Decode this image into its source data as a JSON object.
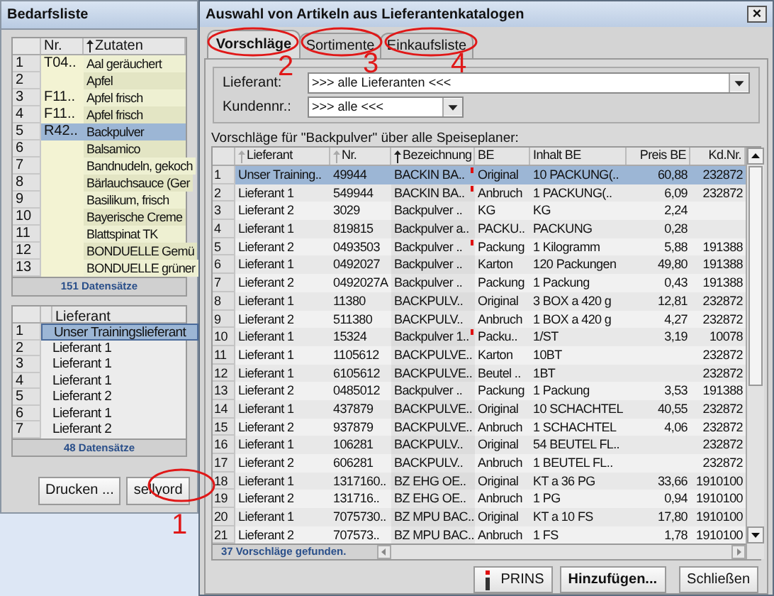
{
  "left_window": {
    "title": "Bedarfsliste",
    "ingredients_table": {
      "columns": [
        {
          "label": "Nr.",
          "sorted": false
        },
        {
          "label": "Zutaten",
          "sorted": true,
          "active": true
        }
      ],
      "rows": [
        {
          "num": "1",
          "nr": "T04..",
          "name": "Aal geräuchert",
          "selected": false
        },
        {
          "num": "2",
          "nr": "",
          "name": "Apfel",
          "selected": false
        },
        {
          "num": "3",
          "nr": "F11..",
          "name": "Apfel frisch",
          "selected": false
        },
        {
          "num": "4",
          "nr": "F11..",
          "name": "Apfel frisch",
          "selected": false
        },
        {
          "num": "5",
          "nr": "R42..",
          "name": "Backpulver",
          "selected": true
        },
        {
          "num": "6",
          "nr": "",
          "name": "Balsamico",
          "selected": false
        },
        {
          "num": "7",
          "nr": "",
          "name": "Bandnudeln, gekoch",
          "selected": false
        },
        {
          "num": "8",
          "nr": "",
          "name": "Bärlauchsauce (Ger",
          "selected": false
        },
        {
          "num": "9",
          "nr": "",
          "name": "Basilikum, frisch",
          "selected": false
        },
        {
          "num": "10",
          "nr": "",
          "name": "Bayerische Creme",
          "selected": false
        },
        {
          "num": "11",
          "nr": "",
          "name": "Blattspinat TK",
          "selected": false
        },
        {
          "num": "12",
          "nr": "",
          "name": "BONDUELLE Gemü",
          "selected": false
        },
        {
          "num": "13",
          "nr": "",
          "name": "BONDUELLE grüner",
          "selected": false
        }
      ],
      "footer": "151 Datensätze"
    },
    "supplier_table": {
      "columns": [
        {
          "label": "Lieferant"
        }
      ],
      "rows": [
        {
          "num": "1",
          "name": "Unser Trainingslieferant",
          "selected": true
        },
        {
          "num": "2",
          "name": "Lieferant 1",
          "selected": false
        },
        {
          "num": "3",
          "name": "Lieferant 1",
          "selected": false
        },
        {
          "num": "4",
          "name": "Lieferant 1",
          "selected": false
        },
        {
          "num": "5",
          "name": "Lieferant 2",
          "selected": false
        },
        {
          "num": "6",
          "name": "Lieferant 1",
          "selected": false
        },
        {
          "num": "7",
          "name": "Lieferant 2",
          "selected": false
        }
      ],
      "footer": "48 Datensätze"
    },
    "buttons": [
      "Drucken ...",
      "sellyord"
    ]
  },
  "dialog": {
    "title": "Auswahl von Artikeln aus Lieferantenkatalogen",
    "close": "×",
    "tabs": [
      {
        "label": "Vorschläge",
        "selected": true
      },
      {
        "label": "Sortimente",
        "selected": false
      },
      {
        "label": "Einkaufsliste",
        "selected": false
      }
    ],
    "filters": [
      {
        "label": "Lieferant:",
        "value": ">>> alle Lieferanten <<<"
      },
      {
        "label": "Kundennr.:",
        "value": ">>> alle <<<"
      }
    ],
    "caption": "Vorschläge für \"Backpulver\" über alle Speiseplaner:",
    "table": {
      "columns": [
        {
          "label": "Lieferant",
          "sorted": true,
          "active": false
        },
        {
          "label": "Nr.",
          "sorted": true,
          "active": false
        },
        {
          "label": "Bezeichnung",
          "sorted": true,
          "active": true
        },
        {
          "label": "BE",
          "sorted": false
        },
        {
          "label": "Inhalt BE",
          "sorted": false
        },
        {
          "label": "Preis BE",
          "sorted": false
        },
        {
          "label": "Kd.Nr.",
          "sorted": false
        }
      ],
      "rows": [
        {
          "num": "1",
          "cells": [
            "Unser Training..",
            "49944",
            "BACKIN BA..",
            "Original",
            "10 PACKUNG(..",
            "60,88",
            "232872"
          ],
          "flagged": true,
          "selected": true
        },
        {
          "num": "2",
          "cells": [
            "Lieferant 1",
            "549944",
            "BACKIN BA..",
            "Anbruch",
            "1 PACKUNG(..",
            "6,09",
            "232872"
          ],
          "flagged": true,
          "selected": false
        },
        {
          "num": "3",
          "cells": [
            "Lieferant 2",
            "3029",
            "Backpulver ..",
            "KG",
            "KG",
            "2,24",
            ""
          ],
          "flagged": false,
          "selected": false
        },
        {
          "num": "4",
          "cells": [
            "Lieferant 1",
            "819815",
            "Backpulver a..",
            "PACKU..",
            "PACKUNG",
            "0,28",
            ""
          ],
          "flagged": false,
          "selected": false
        },
        {
          "num": "5",
          "cells": [
            "Lieferant 2",
            "0493503",
            "Backpulver ..",
            "Packung",
            "1 Kilogramm",
            "5,88",
            "191388"
          ],
          "flagged": true,
          "selected": false
        },
        {
          "num": "6",
          "cells": [
            "Lieferant 1",
            "0492027",
            "Backpulver ..",
            "Karton",
            "120 Packungen",
            "49,80",
            "191388"
          ],
          "flagged": false,
          "selected": false
        },
        {
          "num": "7",
          "cells": [
            "Lieferant 2",
            "0492027A",
            "Backpulver ..",
            "Packung",
            "1 Packung",
            "0,43",
            "191388"
          ],
          "flagged": false,
          "selected": false
        },
        {
          "num": "8",
          "cells": [
            "Lieferant 1",
            "11380",
            "BACKPULV..",
            "Original",
            "3 BOX a 420 g",
            "12,81",
            "232872"
          ],
          "flagged": false,
          "selected": false
        },
        {
          "num": "9",
          "cells": [
            "Lieferant 2",
            "511380",
            "BACKPULV..",
            "Anbruch",
            "1 BOX a 420 g",
            "4,27",
            "232872"
          ],
          "flagged": false,
          "selected": false
        },
        {
          "num": "10",
          "cells": [
            "Lieferant 1",
            "15324",
            "Backpulver 1..",
            "Packu..",
            "1/ST",
            "3,19",
            "10078"
          ],
          "flagged": true,
          "selected": false
        },
        {
          "num": "11",
          "cells": [
            "Lieferant 1",
            "1105612",
            "BACKPULVE..",
            "Karton",
            "10BT",
            "",
            "232872"
          ],
          "flagged": false,
          "selected": false
        },
        {
          "num": "12",
          "cells": [
            "Lieferant 1",
            "6105612",
            "BACKPULVE..",
            "Beutel ..",
            "1BT",
            "",
            "232872"
          ],
          "flagged": false,
          "selected": false
        },
        {
          "num": "13",
          "cells": [
            "Lieferant 2",
            "0485012",
            "Backpulver ..",
            "Packung",
            "1 Packung",
            "3,53",
            "191388"
          ],
          "flagged": false,
          "selected": false
        },
        {
          "num": "14",
          "cells": [
            "Lieferant 1",
            "437879",
            "BACKPULVE..",
            "Original",
            "10 SCHACHTEL",
            "40,55",
            "232872"
          ],
          "flagged": false,
          "selected": false
        },
        {
          "num": "15",
          "cells": [
            "Lieferant 2",
            "937879",
            "BACKPULVE..",
            "Anbruch",
            "1 SCHACHTEL",
            "4,06",
            "232872"
          ],
          "flagged": false,
          "selected": false
        },
        {
          "num": "16",
          "cells": [
            "Lieferant 1",
            "106281",
            "BACKPULV..",
            "Original",
            "54 BEUTEL FL..",
            "",
            "232872"
          ],
          "flagged": false,
          "selected": false
        },
        {
          "num": "17",
          "cells": [
            "Lieferant 2",
            "606281",
            "BACKPULV..",
            "Anbruch",
            "1 BEUTEL FL..",
            "",
            "232872"
          ],
          "flagged": false,
          "selected": false
        },
        {
          "num": "18",
          "cells": [
            "Lieferant 1",
            "1317160..",
            "BZ EHG OE..",
            "Original",
            "KT a 36 PG",
            "33,66",
            "1910100"
          ],
          "flagged": false,
          "selected": false
        },
        {
          "num": "19",
          "cells": [
            "Lieferant 2",
            "131716..",
            "BZ EHG OE..",
            "Anbruch",
            "1 PG",
            "0,94",
            "1910100"
          ],
          "flagged": false,
          "selected": false
        },
        {
          "num": "20",
          "cells": [
            "Lieferant 1",
            "7075730..",
            "BZ MPU BAC..",
            "Original",
            "KT a 10 FS",
            "17,80",
            "1910100"
          ],
          "flagged": false,
          "selected": false
        },
        {
          "num": "21",
          "cells": [
            "Lieferant 2",
            "707573..",
            "BZ MPU BAC..",
            "Anbruch",
            "1 FS",
            "1,78",
            "1910100"
          ],
          "flagged": false,
          "selected": false
        }
      ],
      "footer": "37 Vorschläge gefunden."
    },
    "buttons": [
      {
        "label": "PRINS",
        "kind": "info"
      },
      {
        "label": "Hinzufügen...",
        "kind": "default"
      },
      {
        "label": "Schließen",
        "kind": "plain"
      }
    ]
  },
  "annotations": [
    "1",
    "2",
    "3",
    "4"
  ]
}
